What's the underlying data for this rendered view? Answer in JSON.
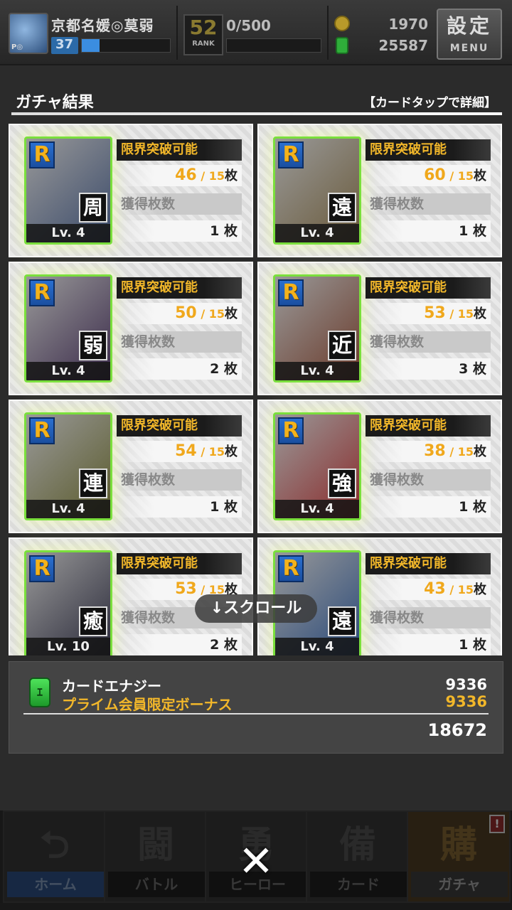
{
  "header": {
    "player_name": "京都名媛◎莫弱",
    "player_level": "37",
    "exp_fraction": 0.2,
    "avatar_tag": "P◎",
    "rank_value": "52",
    "rank_label": "RANK",
    "stamina_text": "0/500",
    "gold": "1970",
    "card_energy": "25587",
    "menu_top": "設定",
    "menu_bottom": "MENU"
  },
  "result": {
    "title": "ガチャ結果",
    "hint": "【カードタップで詳細】",
    "scroll_hint": "↓スクロール"
  },
  "cards": [
    {
      "rarity": "R",
      "type": "周",
      "level": "Lv. 4",
      "limit_label": "限界突破可能",
      "current": "46",
      "max": "/ 15",
      "unit": "枚",
      "acquired_label": "獲得枚数",
      "acquired": "1 枚",
      "art_color": "#3a4a6a"
    },
    {
      "rarity": "R",
      "type": "遠",
      "level": "Lv. 4",
      "limit_label": "限界突破可能",
      "current": "60",
      "max": "/ 15",
      "unit": "枚",
      "acquired_label": "獲得枚数",
      "acquired": "1 枚",
      "art_color": "#6a5a3a"
    },
    {
      "rarity": "R",
      "type": "弱",
      "level": "Lv. 4",
      "limit_label": "限界突破可能",
      "current": "50",
      "max": "/ 15",
      "unit": "枚",
      "acquired_label": "獲得枚数",
      "acquired": "2 枚",
      "art_color": "#3a2a4a"
    },
    {
      "rarity": "R",
      "type": "近",
      "level": "Lv. 4",
      "limit_label": "限界突破可能",
      "current": "53",
      "max": "/ 15",
      "unit": "枚",
      "acquired_label": "獲得枚数",
      "acquired": "3 枚",
      "art_color": "#6a3a2a"
    },
    {
      "rarity": "R",
      "type": "連",
      "level": "Lv. 4",
      "limit_label": "限界突破可能",
      "current": "54",
      "max": "/ 15",
      "unit": "枚",
      "acquired_label": "獲得枚数",
      "acquired": "1 枚",
      "art_color": "#5a5a2a"
    },
    {
      "rarity": "R",
      "type": "強",
      "level": "Lv. 4",
      "limit_label": "限界突破可能",
      "current": "38",
      "max": "/ 15",
      "unit": "枚",
      "acquired_label": "獲得枚数",
      "acquired": "1 枚",
      "art_color": "#8a2a2a"
    },
    {
      "rarity": "R",
      "type": "癒",
      "level": "Lv. 10",
      "limit_label": "限界突破可能",
      "current": "53",
      "max": "/ 15",
      "unit": "枚",
      "acquired_label": "獲得枚数",
      "acquired": "2 枚",
      "art_color": "#2a2a3a"
    },
    {
      "rarity": "R",
      "type": "遠",
      "level": "Lv. 4",
      "limit_label": "限界突破可能",
      "current": "43",
      "max": "/ 15",
      "unit": "枚",
      "acquired_label": "獲得枚数",
      "acquired": "1 枚",
      "art_color": "#2a4a7a"
    }
  ],
  "energy": {
    "label": "カードエナジー",
    "icon_glyph": "ｴ",
    "bonus_label": "プライム会員限定ボーナス",
    "amount": "9336",
    "bonus_amount": "9336",
    "total": "18672"
  },
  "nav": {
    "home": "ホーム",
    "battle": "バトル",
    "hero": "ヒーロー",
    "card": "カード",
    "gacha": "ガチャ",
    "battle_glyph": "闘",
    "hero_glyph": "勇",
    "card_glyph": "備",
    "gacha_glyph": "購",
    "home_glyph": "⮌",
    "notif": "!",
    "close": "✕"
  }
}
